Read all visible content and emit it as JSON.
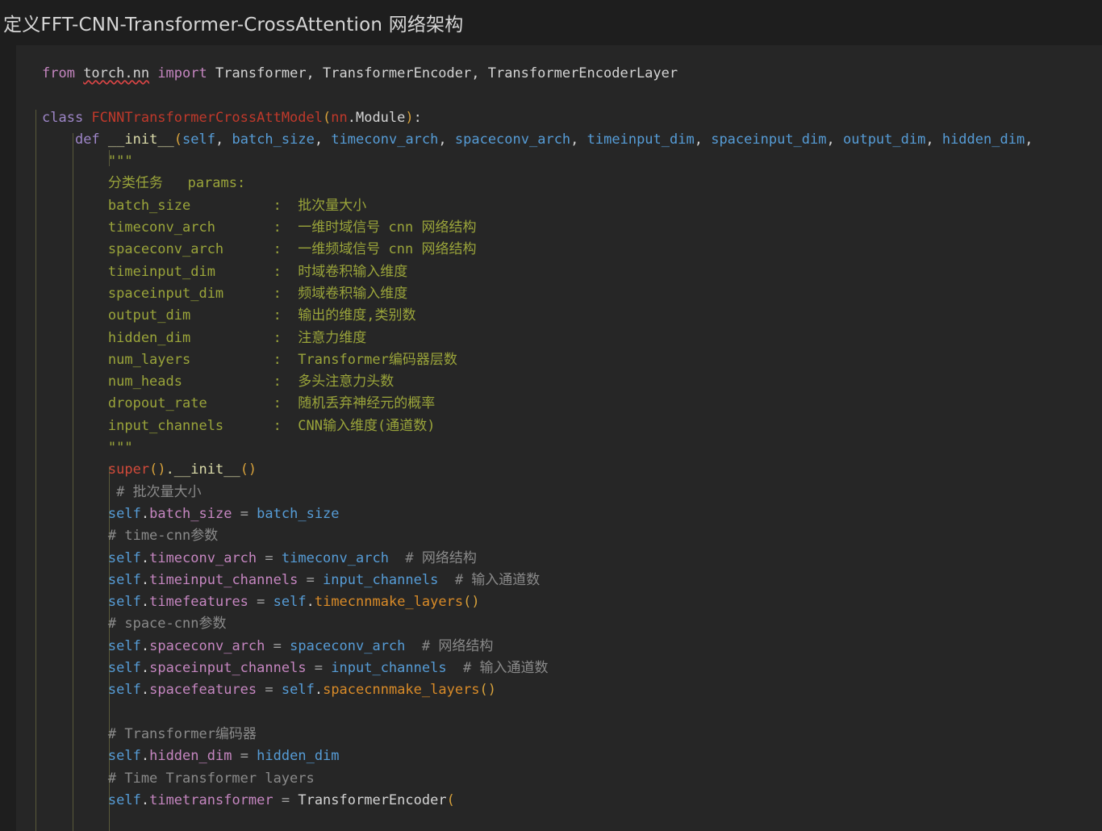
{
  "header": {
    "title": "定义FFT-CNN-Transformer-CrossAttention 网络架构"
  },
  "theme": {
    "header_bg": "#1e1e1e",
    "code_bg": "#262626",
    "default_text": "#d4d4d4",
    "keyword": "#c586c0",
    "class_name": "#c0392b",
    "builtin": "#d14a3a",
    "bracket": "#d7a13b",
    "parameter": "#569cd6",
    "attribute": "#c586c0",
    "method_call": "#d98b28",
    "comment": "#8a8a8a",
    "docstring": "#9aa43a",
    "indent_guide": "#5a5a3a",
    "error_squiggle": "#d84545"
  },
  "code": {
    "language": "python",
    "lines": [
      {
        "n": 1,
        "segments": [
          {
            "t": "from ",
            "c": "kw"
          },
          {
            "t": "torch.nn",
            "c": "mod squiggle"
          },
          {
            "t": " import ",
            "c": "kw"
          },
          {
            "t": "Transformer, TransformerEncoder, TransformerEncoderLayer",
            "c": "plain"
          }
        ]
      },
      {
        "n": 2,
        "segments": []
      },
      {
        "n": 3,
        "segments": [
          {
            "t": "class ",
            "c": "kw2"
          },
          {
            "t": "FCNNTransformerCrossAttModel",
            "c": "cls"
          },
          {
            "t": "(",
            "c": "paren"
          },
          {
            "t": "nn",
            "c": "cls"
          },
          {
            "t": ".Module",
            "c": "plain"
          },
          {
            "t": ")",
            "c": "paren"
          },
          {
            "t": ":",
            "c": "plain"
          }
        ]
      },
      {
        "n": 4,
        "segments": [
          {
            "t": "    ",
            "c": "plain"
          },
          {
            "t": "def ",
            "c": "kw2"
          },
          {
            "t": "__init__",
            "c": "fn"
          },
          {
            "t": "(",
            "c": "paren"
          },
          {
            "t": "self",
            "c": "selfkw"
          },
          {
            "t": ", ",
            "c": "plain"
          },
          {
            "t": "batch_size",
            "c": "selfkw"
          },
          {
            "t": ", ",
            "c": "plain"
          },
          {
            "t": "timeconv_arch",
            "c": "selfkw"
          },
          {
            "t": ", ",
            "c": "plain"
          },
          {
            "t": "spaceconv_arch",
            "c": "selfkw"
          },
          {
            "t": ", ",
            "c": "plain"
          },
          {
            "t": "timeinput_dim",
            "c": "selfkw"
          },
          {
            "t": ", ",
            "c": "plain"
          },
          {
            "t": "spaceinput_dim",
            "c": "selfkw"
          },
          {
            "t": ", ",
            "c": "plain"
          },
          {
            "t": "output_dim",
            "c": "selfkw"
          },
          {
            "t": ", ",
            "c": "plain"
          },
          {
            "t": "hidden_dim",
            "c": "selfkw"
          },
          {
            "t": ",",
            "c": "plain"
          }
        ]
      },
      {
        "n": 5,
        "segments": [
          {
            "t": "        \"\"\"",
            "c": "doc"
          }
        ]
      },
      {
        "n": 6,
        "segments": [
          {
            "t": "        分类任务   params:",
            "c": "doc"
          }
        ]
      },
      {
        "n": 7,
        "segments": [
          {
            "t": "        batch_size          :  批次量大小",
            "c": "doc"
          }
        ]
      },
      {
        "n": 8,
        "segments": [
          {
            "t": "        timeconv_arch       :  一维时域信号 cnn 网络结构",
            "c": "doc"
          }
        ]
      },
      {
        "n": 9,
        "segments": [
          {
            "t": "        spaceconv_arch      :  一维频域信号 cnn 网络结构",
            "c": "doc"
          }
        ]
      },
      {
        "n": 10,
        "segments": [
          {
            "t": "        timeinput_dim       :  时域卷积输入维度",
            "c": "doc"
          }
        ]
      },
      {
        "n": 11,
        "segments": [
          {
            "t": "        spaceinput_dim      :  频域卷积输入维度",
            "c": "doc"
          }
        ]
      },
      {
        "n": 12,
        "segments": [
          {
            "t": "        output_dim          :  输出的维度,类别数",
            "c": "doc"
          }
        ]
      },
      {
        "n": 13,
        "segments": [
          {
            "t": "        hidden_dim          :  注意力维度",
            "c": "doc"
          }
        ]
      },
      {
        "n": 14,
        "segments": [
          {
            "t": "        num_layers          :  Transformer编码器层数",
            "c": "doc"
          }
        ]
      },
      {
        "n": 15,
        "segments": [
          {
            "t": "        num_heads           :  多头注意力头数",
            "c": "doc"
          }
        ]
      },
      {
        "n": 16,
        "segments": [
          {
            "t": "        dropout_rate        :  随机丢弃神经元的概率",
            "c": "doc"
          }
        ]
      },
      {
        "n": 17,
        "segments": [
          {
            "t": "        input_channels      :  CNN输入维度(通道数)",
            "c": "doc"
          }
        ]
      },
      {
        "n": 18,
        "segments": [
          {
            "t": "        \"\"\"",
            "c": "doc"
          }
        ]
      },
      {
        "n": 19,
        "segments": [
          {
            "t": "        ",
            "c": "plain"
          },
          {
            "t": "super",
            "c": "builtin"
          },
          {
            "t": "()",
            "c": "paren"
          },
          {
            "t": ".__init__",
            "c": "fn"
          },
          {
            "t": "()",
            "c": "paren"
          }
        ]
      },
      {
        "n": 20,
        "segments": [
          {
            "t": "         # 批次量大小",
            "c": "com"
          }
        ]
      },
      {
        "n": 21,
        "segments": [
          {
            "t": "        ",
            "c": "plain"
          },
          {
            "t": "self",
            "c": "selfkw"
          },
          {
            "t": ".",
            "c": "plain"
          },
          {
            "t": "batch_size",
            "c": "attr"
          },
          {
            "t": " = ",
            "c": "op"
          },
          {
            "t": "batch_size",
            "c": "selfkw"
          }
        ]
      },
      {
        "n": 22,
        "segments": [
          {
            "t": "        # time-cnn参数",
            "c": "com"
          }
        ]
      },
      {
        "n": 23,
        "segments": [
          {
            "t": "        ",
            "c": "plain"
          },
          {
            "t": "self",
            "c": "selfkw"
          },
          {
            "t": ".",
            "c": "plain"
          },
          {
            "t": "timeconv_arch",
            "c": "attr"
          },
          {
            "t": " = ",
            "c": "op"
          },
          {
            "t": "timeconv_arch",
            "c": "selfkw"
          },
          {
            "t": "  # 网络结构",
            "c": "com"
          }
        ]
      },
      {
        "n": 24,
        "segments": [
          {
            "t": "        ",
            "c": "plain"
          },
          {
            "t": "self",
            "c": "selfkw"
          },
          {
            "t": ".",
            "c": "plain"
          },
          {
            "t": "timeinput_channels",
            "c": "attr"
          },
          {
            "t": " = ",
            "c": "op"
          },
          {
            "t": "input_channels",
            "c": "selfkw"
          },
          {
            "t": "  # 输入通道数",
            "c": "com"
          }
        ]
      },
      {
        "n": 25,
        "segments": [
          {
            "t": "        ",
            "c": "plain"
          },
          {
            "t": "self",
            "c": "selfkw"
          },
          {
            "t": ".",
            "c": "plain"
          },
          {
            "t": "timefeatures",
            "c": "attr"
          },
          {
            "t": " = ",
            "c": "op"
          },
          {
            "t": "self",
            "c": "selfkw"
          },
          {
            "t": ".",
            "c": "plain"
          },
          {
            "t": "timecnnmake_layers",
            "c": "meth"
          },
          {
            "t": "()",
            "c": "paren"
          }
        ]
      },
      {
        "n": 26,
        "segments": [
          {
            "t": "        # space-cnn参数",
            "c": "com"
          }
        ]
      },
      {
        "n": 27,
        "segments": [
          {
            "t": "        ",
            "c": "plain"
          },
          {
            "t": "self",
            "c": "selfkw"
          },
          {
            "t": ".",
            "c": "plain"
          },
          {
            "t": "spaceconv_arch",
            "c": "attr"
          },
          {
            "t": " = ",
            "c": "op"
          },
          {
            "t": "spaceconv_arch",
            "c": "selfkw"
          },
          {
            "t": "  # 网络结构",
            "c": "com"
          }
        ]
      },
      {
        "n": 28,
        "segments": [
          {
            "t": "        ",
            "c": "plain"
          },
          {
            "t": "self",
            "c": "selfkw"
          },
          {
            "t": ".",
            "c": "plain"
          },
          {
            "t": "spaceinput_channels",
            "c": "attr"
          },
          {
            "t": " = ",
            "c": "op"
          },
          {
            "t": "input_channels",
            "c": "selfkw"
          },
          {
            "t": "  # 输入通道数",
            "c": "com"
          }
        ]
      },
      {
        "n": 29,
        "segments": [
          {
            "t": "        ",
            "c": "plain"
          },
          {
            "t": "self",
            "c": "selfkw"
          },
          {
            "t": ".",
            "c": "plain"
          },
          {
            "t": "spacefeatures",
            "c": "attr"
          },
          {
            "t": " = ",
            "c": "op"
          },
          {
            "t": "self",
            "c": "selfkw"
          },
          {
            "t": ".",
            "c": "plain"
          },
          {
            "t": "spacecnnmake_layers",
            "c": "meth"
          },
          {
            "t": "()",
            "c": "paren"
          }
        ]
      },
      {
        "n": 30,
        "segments": []
      },
      {
        "n": 31,
        "segments": [
          {
            "t": "        # Transformer编码器",
            "c": "com"
          }
        ]
      },
      {
        "n": 32,
        "segments": [
          {
            "t": "        ",
            "c": "plain"
          },
          {
            "t": "self",
            "c": "selfkw"
          },
          {
            "t": ".",
            "c": "plain"
          },
          {
            "t": "hidden_dim",
            "c": "attr"
          },
          {
            "t": " = ",
            "c": "op"
          },
          {
            "t": "hidden_dim",
            "c": "selfkw"
          }
        ]
      },
      {
        "n": 33,
        "segments": [
          {
            "t": "        # Time Transformer layers",
            "c": "com"
          }
        ]
      },
      {
        "n": 34,
        "segments": [
          {
            "t": "        ",
            "c": "plain"
          },
          {
            "t": "self",
            "c": "selfkw"
          },
          {
            "t": ".",
            "c": "plain"
          },
          {
            "t": "timetransformer",
            "c": "attr"
          },
          {
            "t": " = ",
            "c": "op"
          },
          {
            "t": "TransformerEncoder",
            "c": "plain"
          },
          {
            "t": "(",
            "c": "paren"
          }
        ]
      }
    ]
  }
}
